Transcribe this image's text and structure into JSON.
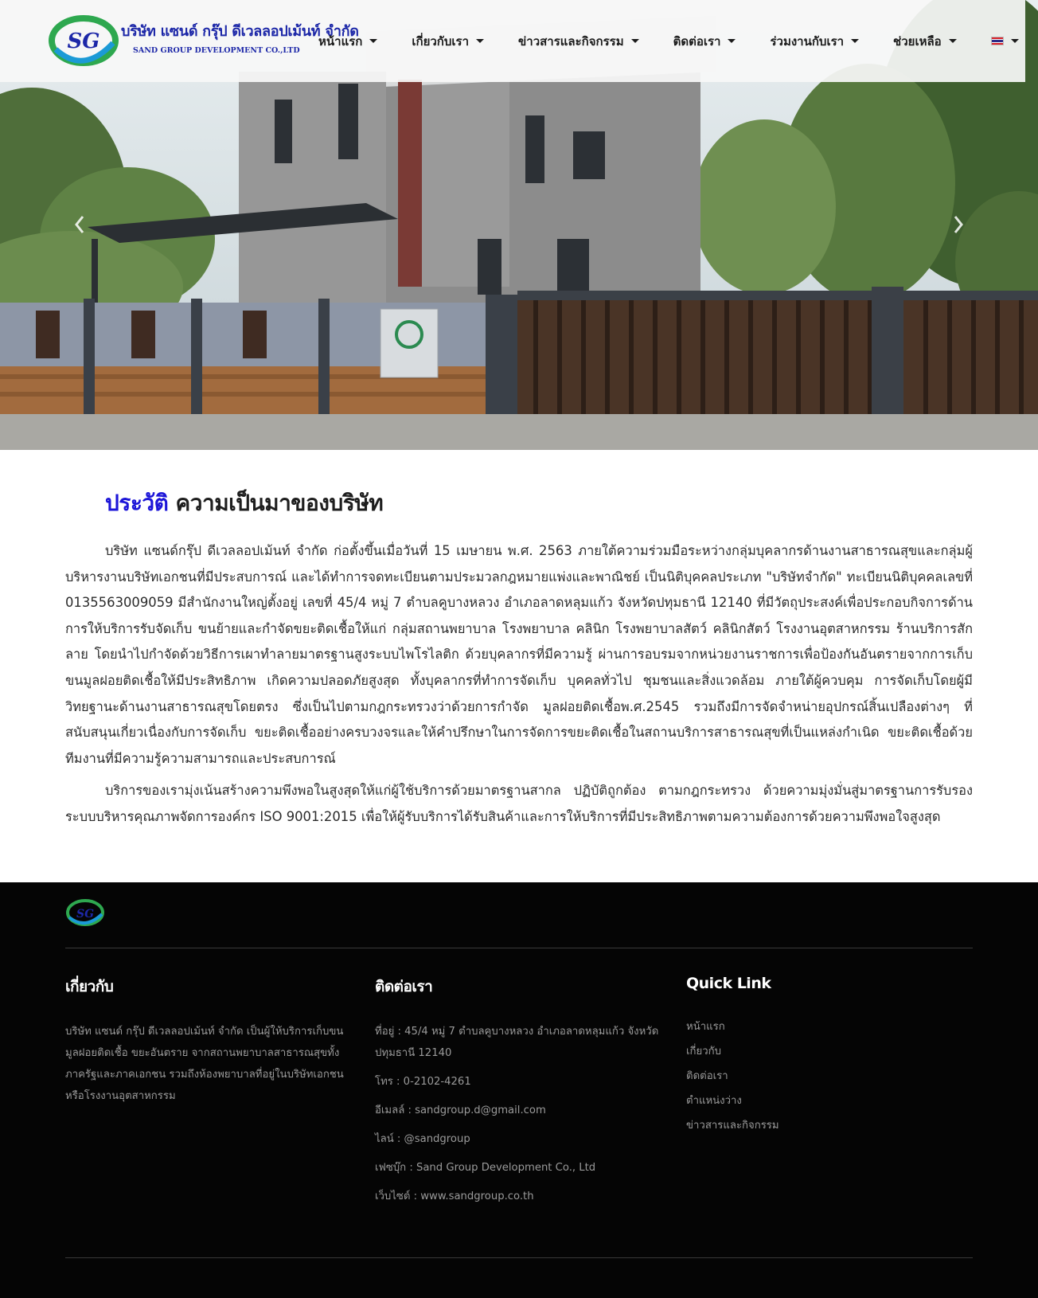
{
  "header": {
    "logo_name_th": "บริษัท แซนด์ กรุ๊ป ดีเวลลอปเม้นท์ จำกัด",
    "logo_name_en": "SAND GROUP DEVELOPMENT CO.,LTD",
    "logo_mark": "SG",
    "nav": [
      {
        "label": "หน้าแรก"
      },
      {
        "label": "เกี่ยวกับเรา"
      },
      {
        "label": "ข่าวสารและกิจกรรม"
      },
      {
        "label": "ติดต่อเรา"
      },
      {
        "label": "ร่วมงานกับเรา"
      },
      {
        "label": "ช่วยเหลือ"
      }
    ],
    "language_icon": "thai-flag-icon"
  },
  "hero": {
    "prev_icon": "chevron-left-icon",
    "next_icon": "chevron-right-icon"
  },
  "about": {
    "title_accent": "ประวัติ",
    "title_rest": " ความเป็นมาของบริษัท",
    "paragraphs": [
      "บริษัท แซนด์กรุ๊ป ดีเวลลอปเม้นท์ จำกัด ก่อตั้งขึ้นเมื่อวันที่ 15 เมษายน พ.ศ. 2563 ภายใต้ความร่วมมือระหว่างกลุ่มบุคลากรด้านงานสาธารณสุขและกลุ่มผู้บริหารงานบริษัทเอกชนที่มีประสบการณ์ และได้ทำการจดทะเบียนตามประมวลกฎหมายแพ่งและพาณิชย์ เป็นนิติบุคคลประเภท \"บริษัทจำกัด\" ทะเบียนนิติบุคคลเลขที่ 0135563009059 มีสำนักงานใหญ่ตั้งอยู่ เลขที่ 45/4 หมู่ 7 ตำบลคูบางหลวง อำเภอลาดหลุมแก้ว จังหวัดปทุมธานี 12140 ที่มีวัตถุประสงค์เพื่อประกอบกิจการด้านการให้บริการรับจัดเก็บ ขนย้ายและกำจัดขยะติดเชื้อให้แก่ กลุ่มสถานพยาบาล โรงพยาบาล คลินิก โรงพยาบาลสัตว์ คลินิกสัตว์ โรงงานอุตสาหกรรม ร้านบริการสักลาย โดยนำไปกำจัดด้วยวิธีการเผาทำลายมาตรฐานสูงระบบไพโรไลติก ด้วยบุคลากรที่มีความรู้ ผ่านการอบรมจากหน่วยงานราชการเพื่อป้องกันอันตรายจากการเก็บขนมูลฝอยติดเชื้อให้มีประสิทธิภาพ เกิดความปลอดภัยสูงสุด ทั้งบุคลากรที่ทำการจัดเก็บ บุคคลทั่วไป ชุมชนและสิ่งแวดล้อม ภายใต้ผู้ควบคุม การจัดเก็บโดยผู้มีวิทยฐานะด้านงานสาธารณสุขโดยตรง ซึ่งเป็นไปตามกฎกระทรวงว่าด้วยการกำจัด มูลฝอยติดเชื้อพ.ศ.2545 รวมถึงมีการจัดจำหน่ายอุปกรณ์สิ้นเปลืองต่างๆ ที่สนับสนุนเกี่ยวเนื่องกับการจัดเก็บ ขยะติดเชื้ออย่างครบวงจรและให้คำปรึกษาในการจัดการขยะติดเชื้อในสถานบริการสาธารณสุขที่เป็นแหล่งกำเนิด ขยะติดเชื้อด้วยทีมงานที่มีความรู้ความสามารถและประสบการณ์",
      "บริการของเรามุ่งเน้นสร้างความพึงพอในสูงสุดให้แก่ผู้ใช้บริการด้วยมาตรฐานสากล ปฏิบัติถูกต้อง ตามกฎกระทรวง ด้วยความมุ่งมั่นสู่มาตรฐานการรับรองระบบบริหารคุณภาพจัดการองค์กร ISO 9001:2015 เพื่อให้ผู้รับบริการได้รับสินค้าและการให้บริการที่มีประสิทธิภาพตามความต้องการด้วยความพึงพอใจสูงสุด"
    ]
  },
  "footer": {
    "logo_mark": "SG",
    "about": {
      "heading": "เกี่ยวกับ",
      "text": "บริษัท แซนด์ กรุ๊ป ดีเวลลอปเม้นท์ จำกัด เป็นผู้ให้บริการเก็บขนมูลฝอยติดเชื้อ ขยะอันตราย จากสถานพยาบาลสาธารณสุขทั้งภาครัฐและภาคเอกชน รวมถึงห้องพยาบาลที่อยู่ในบริษัทเอกชนหรือโรงงานอุตสาหกรรม"
    },
    "contact": {
      "heading": "ติดต่อเรา",
      "items": [
        "ที่อยู่ : 45/4 หมู่ 7 ตำบลคูบางหลวง อำเภอลาดหลุมแก้ว จังหวัดปทุมธานี 12140",
        "โทร : 0-2102-4261",
        "อีเมลล์ : sandgroup.d@gmail.com",
        "ไลน์ : @sandgroup",
        "เฟซบุ๊ก : Sand Group Development Co., Ltd",
        "เว็บไซต์ : www.sandgroup.co.th"
      ]
    },
    "quicklink": {
      "heading": "Quick Link",
      "links": [
        "หน้าแรก",
        "เกี่ยวกับ",
        "ติดต่อเรา",
        "ตำแหน่งว่าง",
        "ข่าวสารและกิจกรรม"
      ]
    }
  }
}
